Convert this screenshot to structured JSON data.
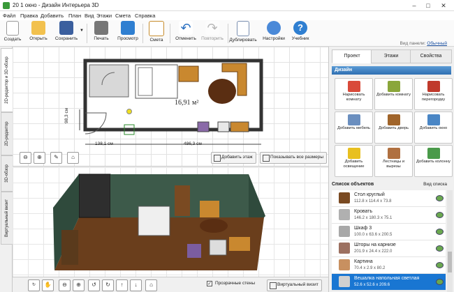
{
  "window": {
    "title": "20 1 окно - Дизайн Интерьера 3D"
  },
  "menu": [
    "Файл",
    "Правка",
    "Добавить",
    "План",
    "Вид",
    "Этажи",
    "Смета",
    "Справка"
  ],
  "toolbar": {
    "create": "Создать",
    "open": "Открыть",
    "save": "Сохранить",
    "print": "Печать",
    "preview": "Просмотр",
    "estimate": "Смета",
    "undo": "Отменить",
    "redo": "Повторить",
    "duplicate": "Дублировать",
    "settings": "Настройки",
    "tutorial": "Учебник"
  },
  "panel_view": {
    "label": "Вид панели:",
    "value": "Обычный"
  },
  "left_tabs": [
    "2D-редактор и 3D-обзор",
    "2D-редактор",
    "3D-обзор",
    "Виртуальный визит"
  ],
  "plan": {
    "area": "16,91 м²",
    "dim_left": "138,1 см",
    "dim_right": "486,3 см",
    "dim_height": "98,3 см"
  },
  "plan_buttons": {
    "add_floor": "Добавить этаж",
    "show_sizes": "Показывать все размеры"
  },
  "bottom": {
    "transparent_walls": "Прозрачные стены",
    "virtual_visit": "Виртуальный визит"
  },
  "right_tabs": [
    "Проект",
    "Этажи",
    "Свойства"
  ],
  "design_header": "Дизайн",
  "design_buttons": [
    {
      "label": "Нарисовать комнату",
      "icon": "draw-room-icon",
      "color": "#d94a3a"
    },
    {
      "label": "Добавить комнату",
      "icon": "add-room-icon",
      "color": "#8aa63a"
    },
    {
      "label": "Нарисовать перегородку",
      "icon": "draw-partition-icon",
      "color": "#c0392b"
    },
    {
      "label": "Добавить мебель",
      "icon": "add-furniture-icon",
      "color": "#6b8fbf"
    },
    {
      "label": "Добавить дверь",
      "icon": "add-door-icon",
      "color": "#a0642a"
    },
    {
      "label": "Добавить окно",
      "icon": "add-window-icon",
      "color": "#4a86c5"
    },
    {
      "label": "Добавить освещение",
      "icon": "add-lighting-icon",
      "color": "#e8c020"
    },
    {
      "label": "Лестницы и вырезы",
      "icon": "stairs-icon",
      "color": "#b07040"
    },
    {
      "label": "Добавить колонну",
      "icon": "add-column-icon",
      "color": "#4a9a4a"
    }
  ],
  "objects_header": "Список объектов",
  "objects_view": "Вид списка",
  "objects": [
    {
      "name": "Стол круглый",
      "dims": "112.8 x 114.4 x 73.8",
      "color": "#7a4a22"
    },
    {
      "name": "Кровать",
      "dims": "146.2 x 180.3 x 75.1",
      "color": "#b0b0b0"
    },
    {
      "name": "Шкаф 3",
      "dims": "100.0 x 63.6 x 200.5",
      "color": "#a8a8a8"
    },
    {
      "name": "Шторы на карнизе",
      "dims": "201.9 x 24.4 x 222.0",
      "color": "#9c7060"
    },
    {
      "name": "Картина",
      "dims": "70.4 x 2.9 x 80.2",
      "color": "#c89060"
    },
    {
      "name": "Вешалка напольная светлая",
      "dims": "52.6 x 52.6 x 209.6",
      "color": "#d0d0d0"
    }
  ]
}
